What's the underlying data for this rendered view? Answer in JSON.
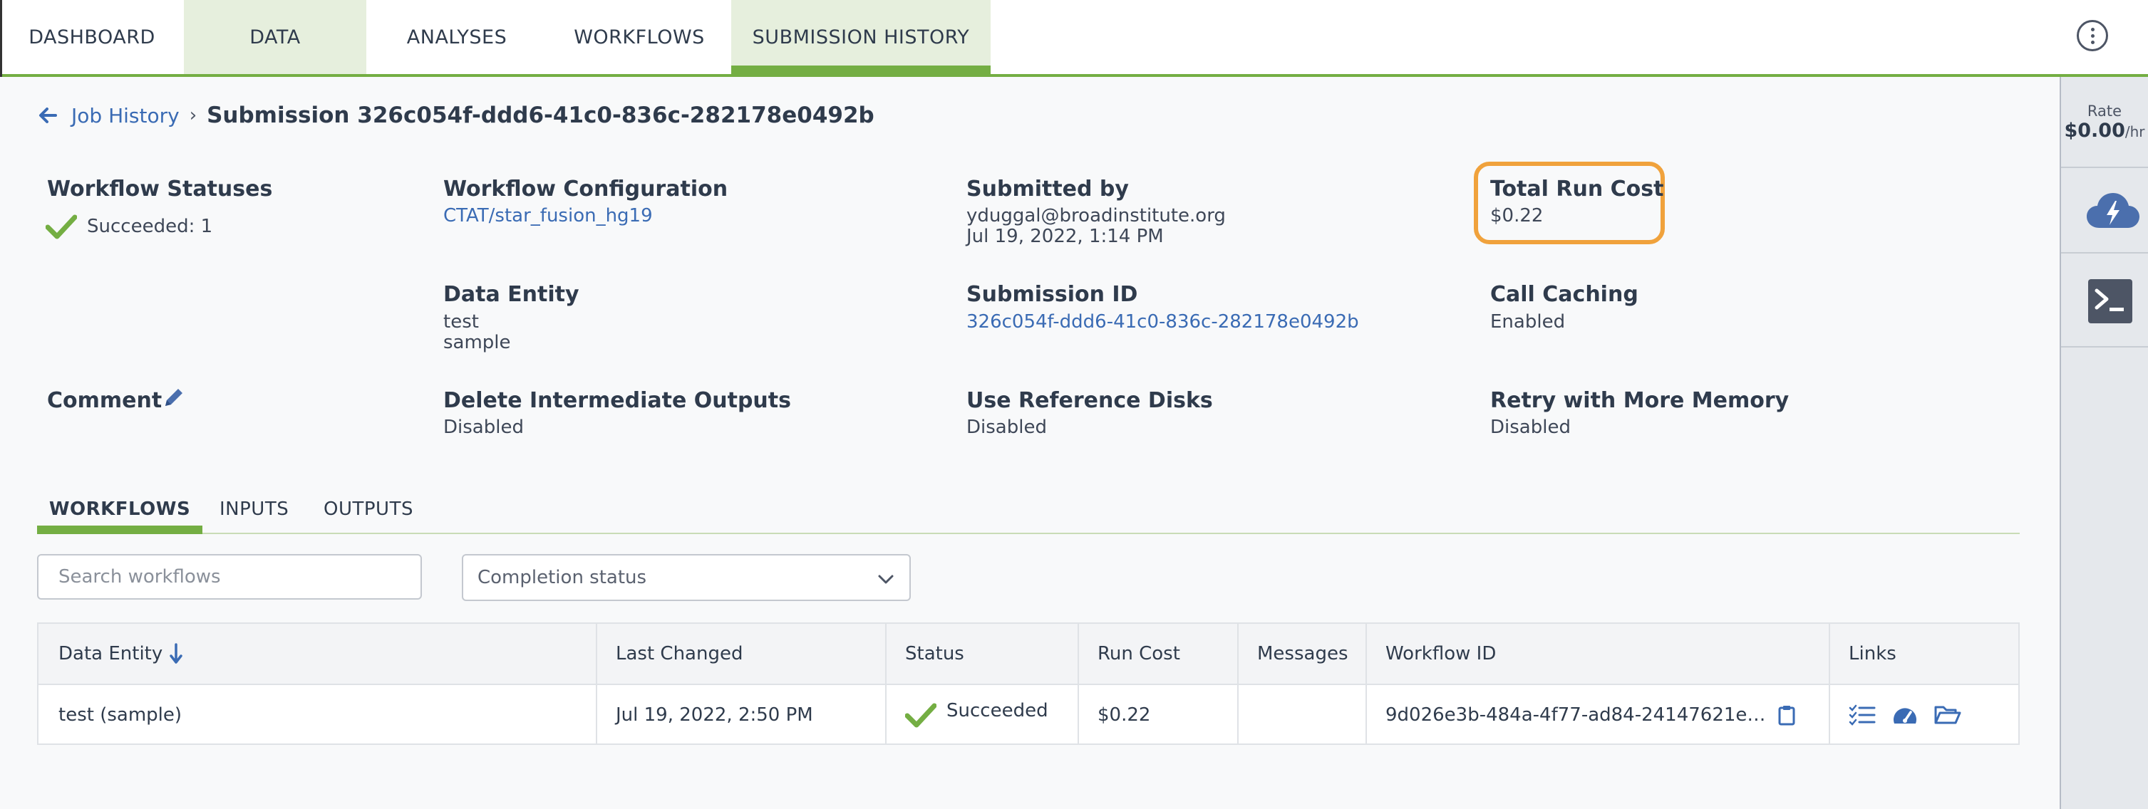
{
  "nav": {
    "tabs": [
      "DASHBOARD",
      "DATA",
      "ANALYSES",
      "WORKFLOWS",
      "SUBMISSION HISTORY"
    ],
    "active": "SUBMISSION HISTORY"
  },
  "rail": {
    "rate_label": "Rate",
    "rate_value": "$0.00",
    "rate_unit": "/hr"
  },
  "breadcrumb": {
    "link": "Job History",
    "title": "Submission 326c054f-ddd6-41c0-836c-282178e0492b"
  },
  "info": {
    "workflow_statuses": {
      "label": "Workflow Statuses",
      "value": "Succeeded: 1"
    },
    "workflow_configuration": {
      "label": "Workflow Configuration",
      "value": "CTAT/star_fusion_hg19"
    },
    "submitted_by": {
      "label": "Submitted by",
      "email": "yduggal@broadinstitute.org",
      "date": "Jul 19, 2022, 1:14 PM"
    },
    "total_run_cost": {
      "label": "Total Run Cost",
      "value": "$0.22"
    },
    "data_entity": {
      "label": "Data Entity",
      "line1": "test",
      "line2": "sample"
    },
    "submission_id": {
      "label": "Submission ID",
      "value": "326c054f-ddd6-41c0-836c-282178e0492b"
    },
    "call_caching": {
      "label": "Call Caching",
      "value": "Enabled"
    },
    "comment": {
      "label": "Comment"
    },
    "delete_intermediate": {
      "label": "Delete Intermediate Outputs",
      "value": "Disabled"
    },
    "reference_disks": {
      "label": "Use Reference Disks",
      "value": "Disabled"
    },
    "retry_memory": {
      "label": "Retry with More Memory",
      "value": "Disabled"
    }
  },
  "subtabs": [
    "WORKFLOWS",
    "INPUTS",
    "OUTPUTS"
  ],
  "filters": {
    "search_placeholder": "Search workflows",
    "status_placeholder": "Completion status"
  },
  "table": {
    "headers": [
      "Data Entity",
      "Last Changed",
      "Status",
      "Run Cost",
      "Messages",
      "Workflow ID",
      "Links"
    ],
    "rows": [
      {
        "data_entity": "test (sample)",
        "last_changed": "Jul 19, 2022, 2:50 PM",
        "status": "Succeeded",
        "run_cost": "$0.22",
        "messages": "",
        "workflow_id": "9d026e3b-484a-4f77-ad84-24147621e…"
      }
    ]
  },
  "colors": {
    "accent_green": "#74ae43",
    "link_blue": "#3a6bb4",
    "highlight_orange": "#f0a23c"
  }
}
